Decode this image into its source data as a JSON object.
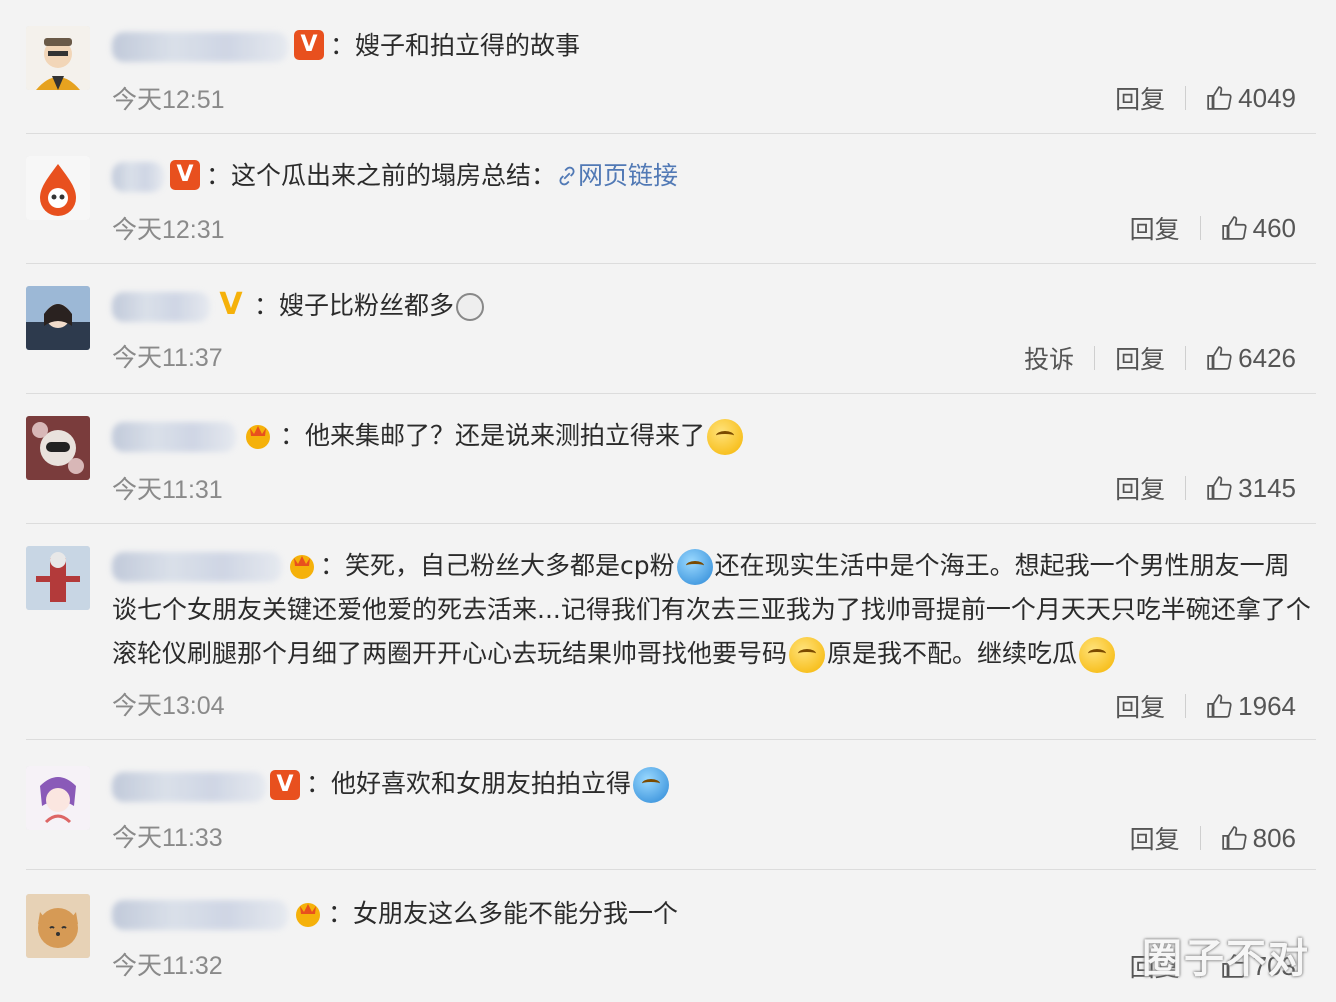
{
  "comments": [
    {
      "text": "：嫂子和拍立得的故事",
      "time": "今天12:51",
      "reply": "回复",
      "likes": "4049",
      "badge": "v-red"
    },
    {
      "text_before": "：这个瓜出来之前的塌房总结：",
      "link": "网页链接",
      "time": "今天12:31",
      "reply": "回复",
      "likes": "460",
      "badge": "v-red"
    },
    {
      "text": "：嫂子比粉丝都多",
      "time": "今天11:37",
      "report": "投诉",
      "reply": "回复",
      "likes": "6426",
      "badge": "v-gold"
    },
    {
      "text": "：他来集邮了？还是说来测拍立得来了",
      "time": "今天11:31",
      "reply": "回复",
      "likes": "3145",
      "badge": "crown"
    },
    {
      "line1a": "：笑死，自己粉丝大多都是cp粉",
      "line1b": "还在现实生活中是个海王。想起我一个男性朋友一周",
      "line2": "谈七个女朋友关键还爱他爱的死去活来...记得我们有次去三亚我为了找帅哥提前一个月天天只吃半碗还拿了个",
      "line3a": "滚轮仪刷腿那个月细了两圈开开心心去玩结果帅哥找他要号码",
      "line3b": "原是我不配。继续吃瓜",
      "time": "今天13:04",
      "reply": "回复",
      "likes": "1964",
      "badge": "crown"
    },
    {
      "text": "：他好喜欢和女朋友拍拍立得",
      "time": "今天11:33",
      "reply": "回复",
      "likes": "806",
      "badge": "v-red"
    },
    {
      "text": "：女朋友这么多能不能分我一个",
      "time": "今天11:32",
      "reply": "回复",
      "likes": "703",
      "badge": "crown"
    }
  ],
  "watermark": "圈子不对",
  "icons": {
    "like": "thumbs-up-icon",
    "link": "link-icon"
  },
  "colors": {
    "badge_red": "#e8501e",
    "badge_gold": "#f5b10a",
    "link": "#5179b5",
    "time": "#8a8a8a"
  }
}
